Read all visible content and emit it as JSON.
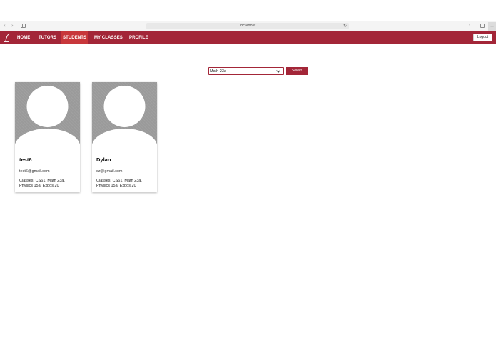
{
  "browser": {
    "nav_arrows": "‹ ›",
    "url": "localhost",
    "reload_icon": "↻",
    "share_icon": "⇪",
    "new_tab_icon": "+"
  },
  "nav": {
    "brand_color": "#a32638",
    "active_color": "#c8373b",
    "items": [
      {
        "label": "HOME"
      },
      {
        "label": "TUTORS"
      },
      {
        "label": "STUDENTS",
        "active": true
      },
      {
        "label": "MY CLASSES"
      },
      {
        "label": "PROFILE"
      }
    ],
    "logout_label": "Logout"
  },
  "class_selector": {
    "selected": "Math 23a",
    "button_label": "Select"
  },
  "students": [
    {
      "name": "test6",
      "email": "test6@gmail.com",
      "classes": "Classes: CS61, Math 23a, Physics 15a, Expos 20",
      "avatar_icon": "default-avatar-icon"
    },
    {
      "name": "Dylan",
      "email": "dz@gmail.com",
      "classes": "Classes: CS61, Math 23a, Physics 15a, Expos 20",
      "avatar_icon": "default-avatar-icon"
    }
  ]
}
